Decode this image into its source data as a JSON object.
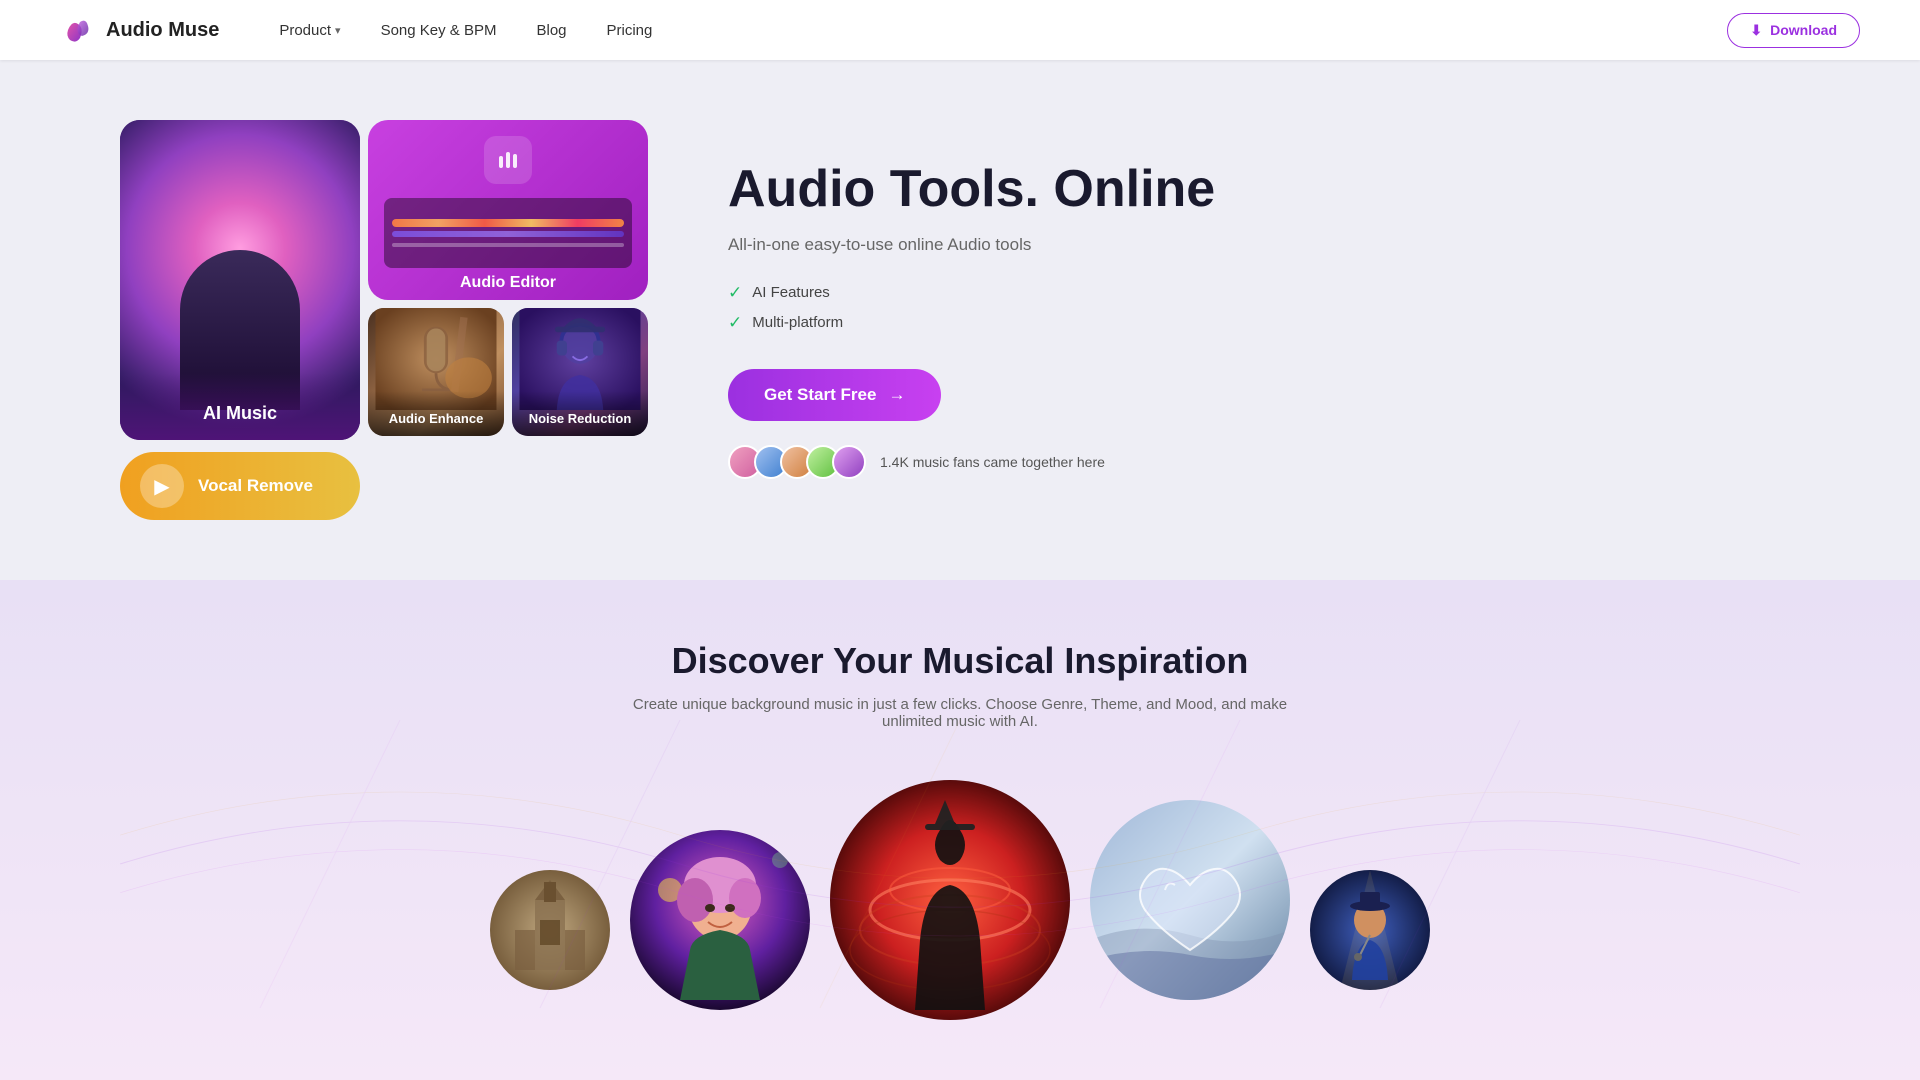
{
  "navbar": {
    "logo_text": "Audio Muse",
    "nav_items": [
      {
        "label": "Product",
        "has_dropdown": true
      },
      {
        "label": "Song Key & BPM",
        "has_dropdown": false
      },
      {
        "label": "Blog",
        "has_dropdown": false
      },
      {
        "label": "Pricing",
        "has_dropdown": false
      }
    ],
    "download_label": "Download"
  },
  "hero": {
    "title": "Audio Tools. Online",
    "subtitle": "All-in-one easy-to-use online Audio tools",
    "features": [
      "AI Features",
      "Multi-platform"
    ],
    "cta_label": "Get Start Free",
    "social_count": "1.4K music fans came together here",
    "cards": {
      "ai_music": "AI Music",
      "vocal_remove": "Vocal Remove",
      "audio_editor": "Audio Editor",
      "audio_enhance": "Audio Enhance",
      "noise_reduction": "Noise Reduction"
    }
  },
  "discover": {
    "title": "Discover Your Musical Inspiration",
    "subtitle": "Create unique background music in just a few clicks. Choose Genre, Theme, and Mood, and make unlimited music with AI."
  },
  "icons": {
    "download": "⬇",
    "chevron_down": "▾",
    "check": "✓",
    "arrow_right": "→",
    "play": "▶"
  }
}
